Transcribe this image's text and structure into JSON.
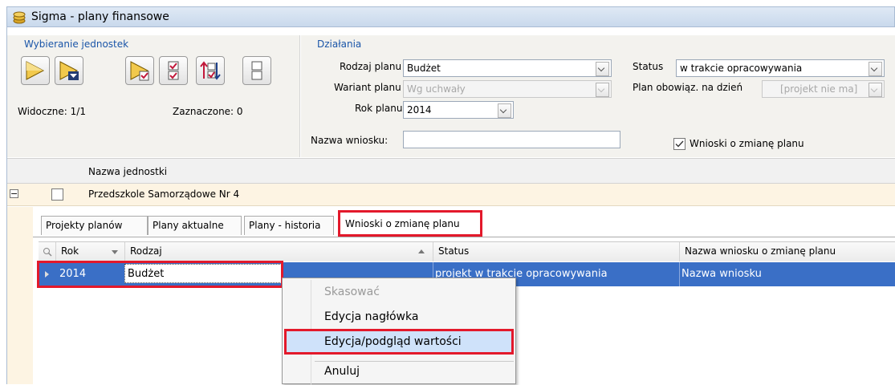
{
  "window": {
    "title": "Sigma - plany finansowe"
  },
  "left_group": {
    "title": "Wybieranie jednostek",
    "visible": "Widoczne: 1/1",
    "selected": "Zaznaczone: 0"
  },
  "actions": {
    "title": "Działania",
    "plan_type_label": "Rodzaj planu",
    "plan_type_value": "Budżet",
    "variant_label": "Wariant planu",
    "variant_value": "Wg uchwały",
    "year_label": "Rok planu",
    "year_value": "2014",
    "request_name_label": "Nazwa wniosku:",
    "request_name_value": "",
    "status_label": "Status",
    "status_value": "w trakcie opracowywania",
    "plan_binding_label": "Plan obowiąz. na dzień",
    "plan_binding_value": "[projekt nie ma]",
    "change_requests_label": "Wnioski o zmianę planu",
    "change_requests_checked": true
  },
  "units_grid": {
    "column_header": "Nazwa jednostki",
    "rows": [
      {
        "name": "Przedszkole Samorządowe Nr 4"
      }
    ]
  },
  "tabs": [
    "Projekty planów",
    "Plany aktualne",
    "Plany - historia",
    "Wnioski o zmianę planu"
  ],
  "plan_grid": {
    "columns": [
      "Rok",
      "Rodzaj",
      "Status",
      "Nazwa wniosku o zmianę planu"
    ],
    "rows": [
      {
        "rok": "2014",
        "rodzaj": "Budżet",
        "status": "projekt w trakcie opracowywania",
        "nazwa": "Nazwa wniosku"
      }
    ]
  },
  "context_menu": {
    "items": [
      "Skasować",
      "Edycja nagłówka",
      "Edycja/podgląd wartości",
      "Anuluj"
    ]
  },
  "colors": {
    "selection": "#3a6fc6",
    "highlight": "#e3192b",
    "group_title": "#1a55a8"
  }
}
